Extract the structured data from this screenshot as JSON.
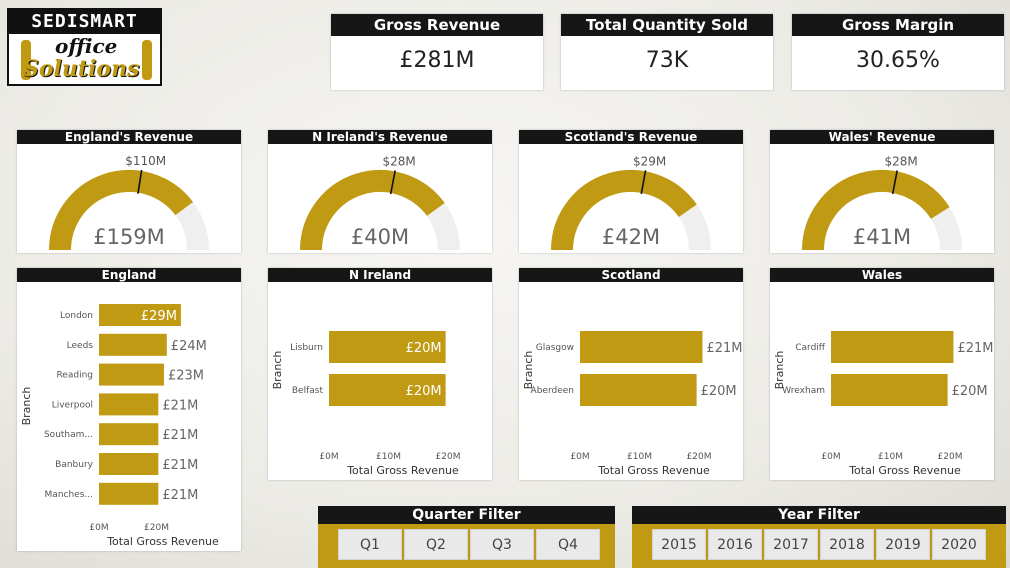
{
  "logo": {
    "top": "SEDISMART",
    "office": "office",
    "solutions": "Solutions"
  },
  "kpis": [
    {
      "title": "Gross Revenue",
      "value": "£281M"
    },
    {
      "title": "Total Quantity Sold",
      "value": "73K"
    },
    {
      "title": "Gross Margin",
      "value": "30.65%"
    }
  ],
  "gauges": [
    {
      "title": "England's Revenue",
      "value": 159,
      "target": 110,
      "max": 200,
      "value_label": "£159M",
      "target_label": "$110M"
    },
    {
      "title": "N Ireland's Revenue",
      "value": 40,
      "target": 28,
      "max": 50,
      "value_label": "£40M",
      "target_label": "$28M"
    },
    {
      "title": "Scotland's Revenue",
      "value": 42,
      "target": 29,
      "max": 52,
      "value_label": "£42M",
      "target_label": "$29M"
    },
    {
      "title": "Wales' Revenue",
      "value": 41,
      "target": 28,
      "max": 50,
      "value_label": "£41M",
      "target_label": "$28M"
    }
  ],
  "colors": {
    "accent": "#c09a12",
    "header": "#161616",
    "track": "#efefef"
  },
  "chart_data": [
    {
      "type": "bar",
      "orientation": "horizontal",
      "title": "England",
      "ylabel": "Branch",
      "xlabel": "Total Gross Revenue",
      "categories": [
        "London",
        "Leeds",
        "Reading",
        "Liverpool",
        "Southam...",
        "Banbury",
        "Manches..."
      ],
      "values": [
        29,
        24,
        23,
        21,
        21,
        21,
        21
      ],
      "data_labels": [
        "£29M",
        "£24M",
        "£23M",
        "£21M",
        "£21M",
        "£21M",
        "£21M"
      ],
      "xticks": [
        "£0M",
        "£20M"
      ],
      "xlim": [
        0,
        40
      ]
    },
    {
      "type": "bar",
      "orientation": "horizontal",
      "title": "N Ireland",
      "ylabel": "Branch",
      "xlabel": "Total Gross Revenue",
      "categories": [
        "Lisburn",
        "Belfast"
      ],
      "values": [
        20,
        20
      ],
      "data_labels": [
        "£20M",
        "£20M"
      ],
      "xticks": [
        "£0M",
        "£10M",
        "£20M"
      ],
      "xlim": [
        0,
        20
      ]
    },
    {
      "type": "bar",
      "orientation": "horizontal",
      "title": "Scotland",
      "ylabel": "Branch",
      "xlabel": "Total Gross Revenue",
      "categories": [
        "Glasgow",
        "Aberdeen"
      ],
      "values": [
        21,
        20
      ],
      "data_labels": [
        "£21M",
        "£20M"
      ],
      "xticks": [
        "£0M",
        "£10M",
        "£20M"
      ],
      "xlim": [
        0,
        20
      ]
    },
    {
      "type": "bar",
      "orientation": "horizontal",
      "title": "Wales",
      "ylabel": "Branch",
      "xlabel": "Total Gross Revenue",
      "categories": [
        "Cardiff",
        "Wrexham"
      ],
      "values": [
        21,
        20
      ],
      "data_labels": [
        "£21M",
        "£20M"
      ],
      "xticks": [
        "£0M",
        "£10M",
        "£20M"
      ],
      "xlim": [
        0,
        20
      ]
    }
  ],
  "quarter_filter": {
    "title": "Quarter Filter",
    "options": [
      "Q1",
      "Q2",
      "Q3",
      "Q4"
    ]
  },
  "year_filter": {
    "title": "Year Filter",
    "options": [
      "2015",
      "2016",
      "2017",
      "2018",
      "2019",
      "2020"
    ]
  }
}
